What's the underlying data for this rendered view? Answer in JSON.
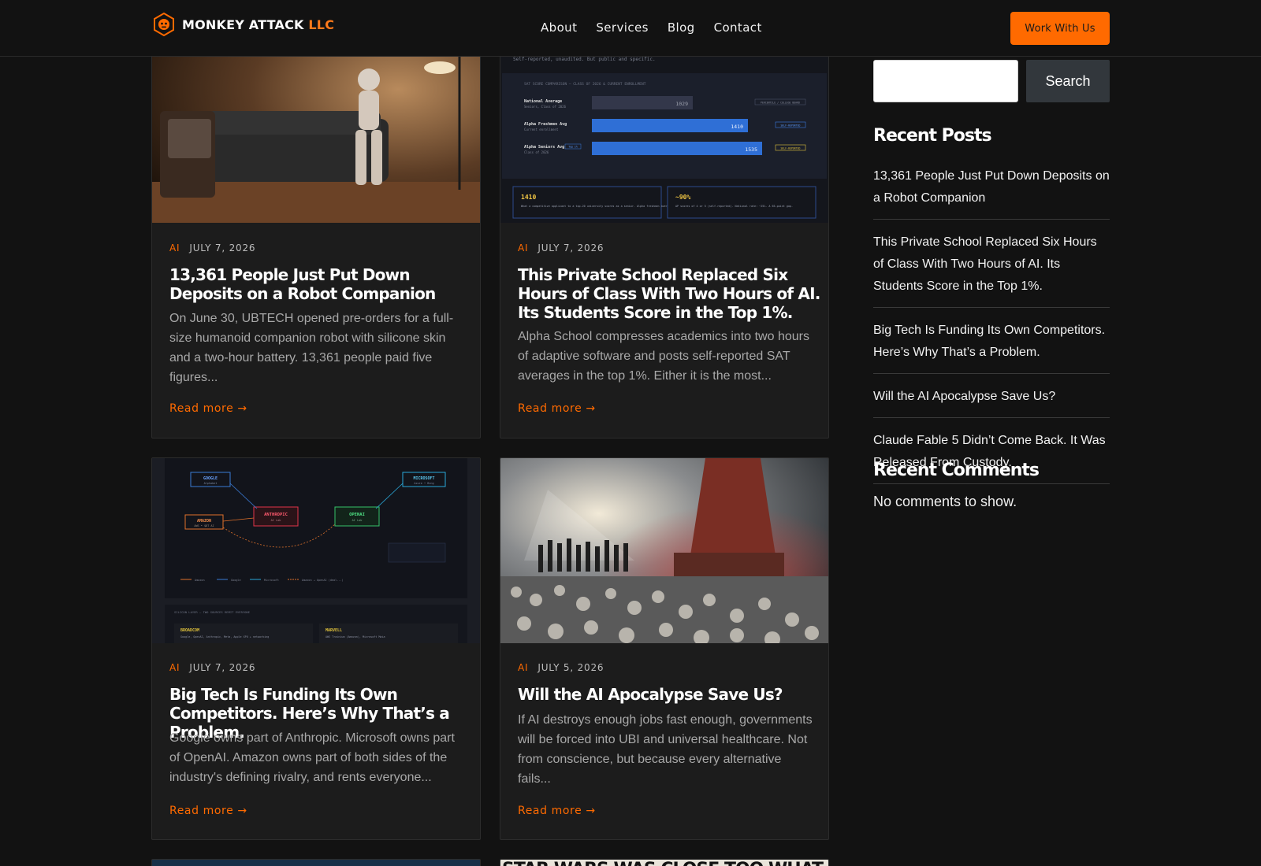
{
  "header": {
    "logo_main": "MONKEY ATTACK",
    "logo_suffix": "LLC",
    "nav": [
      "About",
      "Services",
      "Blog",
      "Contact"
    ],
    "cta_label": "Work With Us"
  },
  "colors": {
    "accent": "#ff6a00",
    "background": "#121212",
    "card": "#1c1c1c"
  },
  "posts": [
    {
      "category": "AI",
      "date": "JULY 7, 2026",
      "title": "13,361 People Just Put Down Deposits on a Robot Companion",
      "excerpt": "On June 30, UBTECH opened pre-orders for a full-size humanoid companion robot with silicone skin and a two-hour battery. 13,361 people paid five figures...",
      "read_more": "Read more →",
      "image_subject": "humanoid robot seated on a sofa"
    },
    {
      "category": "AI",
      "date": "JULY 7, 2026",
      "title": "This Private School Replaced Six Hours of Class With Two Hours of AI. Its Students Score in the Top 1%.",
      "excerpt": "Alpha School compresses academics into two hours of adaptive software and posts self-reported SAT averages in the top 1%. Either it is the most...",
      "read_more": "Read more →",
      "image_subject": "SAT score comparison chart",
      "image_text": {
        "caption": "Self-reported, unaudited. But public and specific.",
        "chart_title": "SAT SCORE COMPARISON — CLASS OF 2026 & CURRENT ENROLLMENT",
        "rows": [
          {
            "label": "National Average",
            "sub": "Seniors, Class of 2026",
            "value": 1029,
            "tag": "PERCENTILE / COLLEGE BOARD"
          },
          {
            "label": "Alpha Freshmen Avg",
            "sub": "Current enrollment",
            "value": 1410,
            "tag": "SELF-REPORTED"
          },
          {
            "label": "Alpha Seniors Avg",
            "sub": "Class of 2026",
            "badge": "Top 1%",
            "value": 1535,
            "tag": "SELF-REPORTED"
          }
        ],
        "stat1_value": "1410",
        "stat1_text": "What a competitive applicant to a top-20 university scores as a senior. Alpha freshmen average it.",
        "stat2_value": "~90%",
        "stat2_text": "AP scores of 4 or 5 (self-reported). National rate: ~25%. A 65-point gap."
      }
    },
    {
      "category": "AI",
      "date": "JULY 7, 2026",
      "title": "Big Tech Is Funding Its Own Competitors. Here’s Why That’s a Problem.",
      "excerpt": "Google owns part of Anthropic. Microsoft owns part of OpenAI. Amazon owns part of both sides of the industry's defining rivalry, and rents everyone...",
      "read_more": "Read more →",
      "image_subject": "big tech investment network diagram",
      "image_text": {
        "nodes": [
          "GOOGLE",
          "MICROSOFT",
          "AMAZON",
          "ANTHROPIC",
          "OPENAI"
        ],
        "node_subs": [
          "Alphabet",
          "Azure • Bing",
          "AWS • $8T AI",
          "AI Lab",
          "AI Lab"
        ],
        "legend": [
          "Amazon",
          "Google",
          "Microsoft",
          "Amazon → OpenAI (deal...)"
        ],
        "bottom_title": "SILICON LAYER — TWO SOURCES REMIT EVERYONE",
        "chips": [
          "BROADCOM",
          "MARVELL"
        ],
        "chip_subs": [
          "Google, OpenAI, Anthropic, Meta, Apple XPU + networking",
          "AWS Trainium (Amazon), Microsoft Maia"
        ]
      }
    },
    {
      "category": "AI",
      "date": "JULY 5, 2026",
      "title": "Will the AI Apocalypse Save Us?",
      "excerpt": "If AI destroys enough jobs fast enough, governments will be forced into UBI and universal healthcare. Not from conscience, but because every alternative fails...",
      "read_more": "Read more →",
      "image_subject": "people facing a giant machine over a field of skulls"
    }
  ],
  "sidebar": {
    "search_placeholder": "",
    "search_button": "Search",
    "recent_posts_title": "Recent Posts",
    "recent_posts": [
      "13,361 People Just Put Down Deposits on a Robot Companion",
      "This Private School Replaced Six Hours of Class With Two Hours of AI. Its Students Score in the Top 1%.",
      "Big Tech Is Funding Its Own Competitors. Here’s Why That’s a Problem.",
      "Will the AI Apocalypse Save Us?",
      "Claude Fable 5 Didn’t Come Back. It Was Released From Custody."
    ],
    "recent_comments_title": "Recent Comments",
    "no_comments": "No comments to show."
  },
  "partial_next_title": "STAR WARS WAS CLOSE TOO WHAT GEORGE"
}
